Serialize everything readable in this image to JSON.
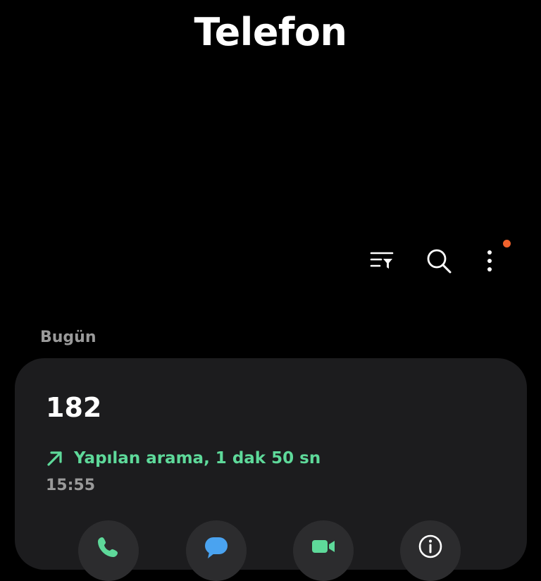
{
  "header": {
    "title": "Telefon"
  },
  "toolbar": {
    "filter_icon": "filter-list-icon",
    "search_icon": "search-icon",
    "more_icon": "more-vertical-icon",
    "notification_dot_color": "#f0622c"
  },
  "call_log": {
    "section_label": "Bugün",
    "entries": [
      {
        "number": "182",
        "type_text": "Yapılan arama, 1 dak 50 sn",
        "type_icon": "outgoing-call-arrow-icon",
        "type_color": "#5ed99a",
        "time": "15:55",
        "actions": [
          {
            "icon": "phone-call-icon",
            "color": "#5ed99a"
          },
          {
            "icon": "message-icon",
            "color": "#4aa3f0"
          },
          {
            "icon": "video-call-icon",
            "color": "#5ed99a"
          },
          {
            "icon": "info-icon",
            "color": "#ffffff"
          }
        ]
      }
    ]
  },
  "colors": {
    "background": "#000000",
    "card": "#1c1c1e",
    "secondary_text": "#9a9a9a",
    "accent_green": "#5ed99a"
  }
}
